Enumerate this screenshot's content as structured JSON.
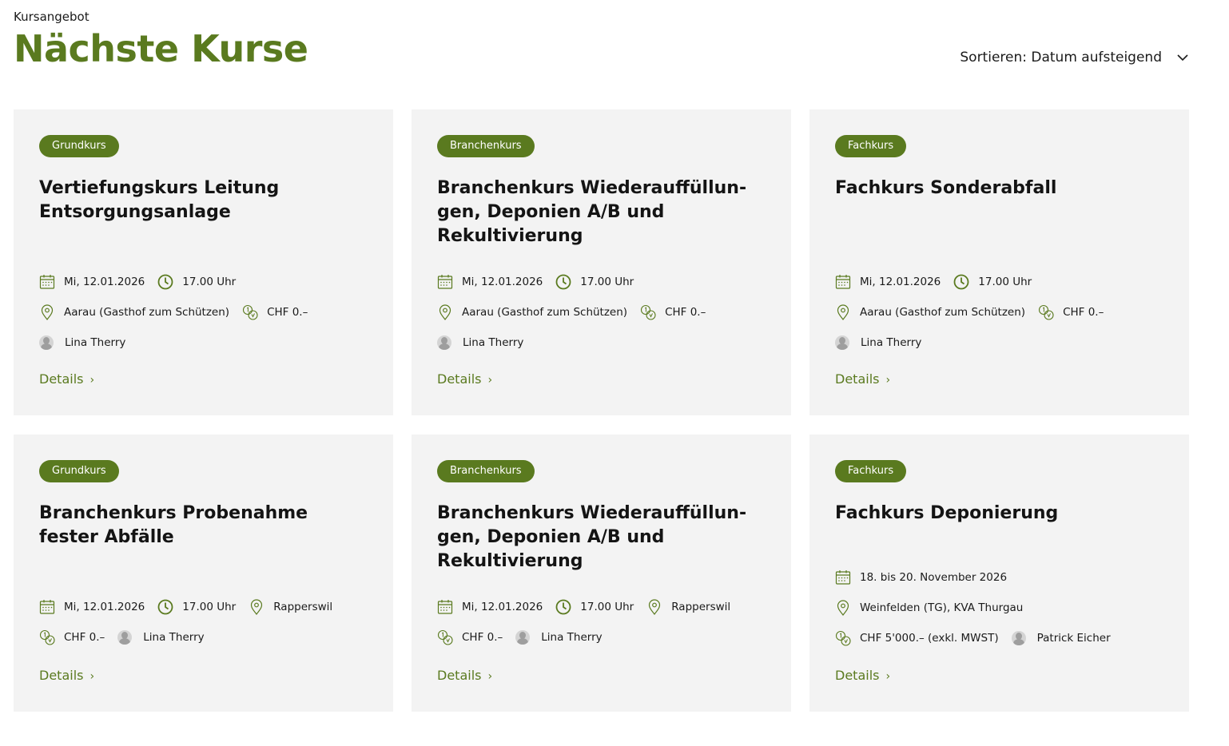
{
  "header": {
    "eyebrow": "Kursangebot",
    "title": "Nächste Kurse",
    "sort_label": "Sortieren: Datum aufsteigend"
  },
  "colors": {
    "accent": "#5a7a1f",
    "card_bg": "#f3f3f3"
  },
  "cards": [
    {
      "badge": "Grundkurs",
      "title": "Vertiefungskurs Leitung Entsorgungsanlage",
      "date": "Mi, 12.01.2026",
      "time": "17.00 Uhr",
      "location": "Aarau (Gasthof zum Schützen)",
      "price": "CHF 0.–",
      "person": "Lina Therry",
      "details": "Details"
    },
    {
      "badge": "Branchenkurs",
      "title": "Branchenkurs Wiederauffüllun-gen, Deponien A/B und Rekultivierung",
      "date": "Mi, 12.01.2026",
      "time": "17.00 Uhr",
      "location": "Aarau (Gasthof zum Schützen)",
      "price": "CHF 0.–",
      "person": "Lina Therry",
      "details": "Details"
    },
    {
      "badge": "Fachkurs",
      "title": "Fachkurs Sonderabfall",
      "date": "Mi, 12.01.2026",
      "time": "17.00 Uhr",
      "location": "Aarau (Gasthof zum Schützen)",
      "price": "CHF 0.–",
      "person": "Lina Therry",
      "details": "Details"
    },
    {
      "badge": "Grundkurs",
      "title": "Branchenkurs Probenahme fester Abfälle",
      "date": "Mi, 12.01.2026",
      "time": "17.00 Uhr",
      "location": "Rapperswil",
      "price": "CHF 0.–",
      "person": "Lina Therry",
      "details": "Details"
    },
    {
      "badge": "Branchenkurs",
      "title": "Branchenkurs Wiederauffüllun-gen, Deponien A/B und Rekultivierung",
      "date": "Mi, 12.01.2026",
      "time": "17.00 Uhr",
      "location": "Rapperswil",
      "price": "CHF 0.–",
      "person": "Lina Therry",
      "details": "Details"
    },
    {
      "badge": "Fachkurs",
      "title": "Fachkurs Deponierung",
      "date": "18. bis 20. November 2026",
      "location": "Weinfelden (TG), KVA Thurgau",
      "price": "CHF 5'000.– (exkl. MWST)",
      "person": "Patrick Eicher",
      "details": "Details"
    }
  ]
}
